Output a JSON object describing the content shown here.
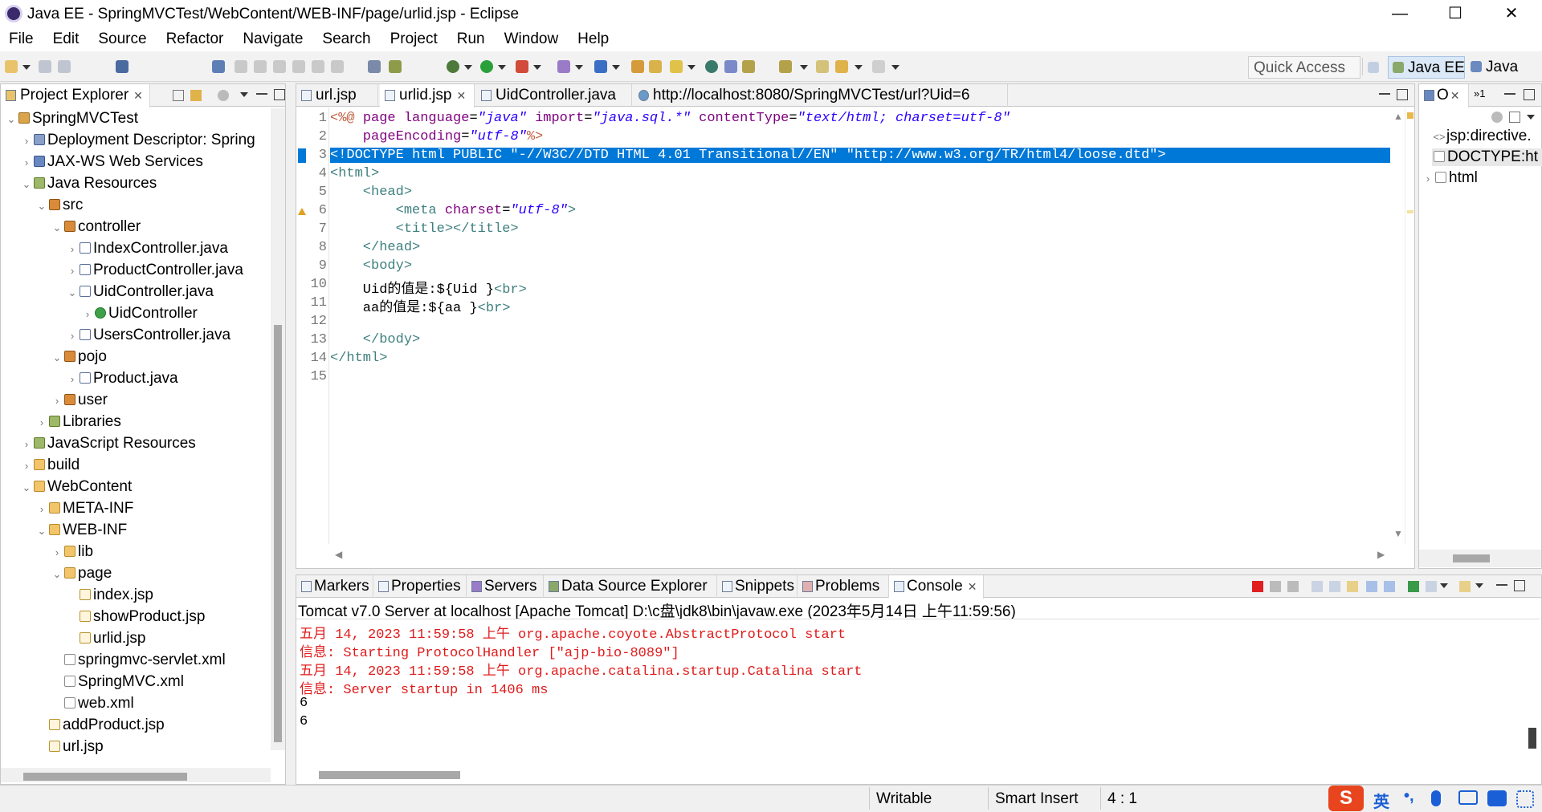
{
  "window": {
    "title": "Java EE - SpringMVCTest/WebContent/WEB-INF/page/urlid.jsp - Eclipse",
    "minimize": "—",
    "maximize": "☐",
    "close": "✕"
  },
  "menu": [
    "File",
    "Edit",
    "Source",
    "Refactor",
    "Navigate",
    "Search",
    "Project",
    "Run",
    "Window",
    "Help"
  ],
  "quick_access": "Quick Access",
  "perspectives": [
    {
      "label": "Java EE",
      "active": true
    },
    {
      "label": "Java",
      "active": false
    }
  ],
  "project_explorer": {
    "title": "Project Explorer",
    "tree": [
      {
        "label": "SpringMVCTest",
        "twisty": "⌄",
        "icon": "proj"
      },
      {
        "label": "Deployment Descriptor: Spring",
        "twisty": "›",
        "icon": "desc"
      },
      {
        "label": "JAX-WS Web Services",
        "twisty": "›",
        "icon": "ws"
      },
      {
        "label": "Java Resources",
        "twisty": "⌄",
        "icon": "lib"
      },
      {
        "label": "src",
        "twisty": "⌄",
        "icon": "pkg"
      },
      {
        "label": "controller",
        "twisty": "⌄",
        "icon": "pkg"
      },
      {
        "label": "IndexController.java",
        "twisty": "›",
        "icon": "java"
      },
      {
        "label": "ProductController.java",
        "twisty": "›",
        "icon": "java"
      },
      {
        "label": "UidController.java",
        "twisty": "⌄",
        "icon": "java"
      },
      {
        "label": "UidController",
        "twisty": "›",
        "icon": "cls"
      },
      {
        "label": "UsersController.java",
        "twisty": "›",
        "icon": "java"
      },
      {
        "label": "pojo",
        "twisty": "⌄",
        "icon": "pkg"
      },
      {
        "label": "Product.java",
        "twisty": "›",
        "icon": "java"
      },
      {
        "label": "user",
        "twisty": "›",
        "icon": "pkg"
      },
      {
        "label": "Libraries",
        "twisty": "›",
        "icon": "lib"
      },
      {
        "label": "JavaScript Resources",
        "twisty": "›",
        "icon": "lib"
      },
      {
        "label": "build",
        "twisty": "›",
        "icon": "folder"
      },
      {
        "label": "WebContent",
        "twisty": "⌄",
        "icon": "folder"
      },
      {
        "label": "META-INF",
        "twisty": "›",
        "icon": "folder"
      },
      {
        "label": "WEB-INF",
        "twisty": "⌄",
        "icon": "folder"
      },
      {
        "label": "lib",
        "twisty": "›",
        "icon": "folder"
      },
      {
        "label": "page",
        "twisty": "⌄",
        "icon": "folder"
      },
      {
        "label": "index.jsp",
        "twisty": "",
        "icon": "jsp"
      },
      {
        "label": "showProduct.jsp",
        "twisty": "",
        "icon": "jsp"
      },
      {
        "label": "urlid.jsp",
        "twisty": "",
        "icon": "jsp"
      },
      {
        "label": "springmvc-servlet.xml",
        "twisty": "",
        "icon": "xml"
      },
      {
        "label": "SpringMVC.xml",
        "twisty": "",
        "icon": "xml"
      },
      {
        "label": "web.xml",
        "twisty": "",
        "icon": "xml"
      },
      {
        "label": "addProduct.jsp",
        "twisty": "",
        "icon": "jsp"
      },
      {
        "label": "url.jsp",
        "twisty": "",
        "icon": "jsp"
      }
    ]
  },
  "editor_tabs": [
    {
      "label": "url.jsp"
    },
    {
      "label": "urlid.jsp",
      "close": "✕"
    },
    {
      "label": "UidController.java"
    },
    {
      "label": "http://localhost:8080/SpringMVCTest/url?Uid=6"
    }
  ],
  "editor_lines": [
    {
      "n": "1"
    },
    {
      "n": "2"
    },
    {
      "n": "3"
    },
    {
      "n": "4"
    },
    {
      "n": "5"
    },
    {
      "n": "6"
    },
    {
      "n": "7"
    },
    {
      "n": "8"
    },
    {
      "n": "9"
    },
    {
      "n": "10"
    },
    {
      "n": "11"
    },
    {
      "n": "12"
    },
    {
      "n": "13"
    },
    {
      "n": "14"
    },
    {
      "n": "15"
    }
  ],
  "code": {
    "l1_a": "<%@ ",
    "l1_b": "page ",
    "l1_c": "language",
    "l1_d": "=",
    "l1_e": "\"java\"",
    "l1_f": " import",
    "l1_g": "=",
    "l1_h": "\"java.sql.*\"",
    "l1_i": " contentType",
    "l1_j": "=",
    "l1_k": "\"text/html; charset=utf-8\"",
    "l2_a": "    pageEncoding",
    "l2_b": "=",
    "l2_c": "\"utf-8\"",
    "l2_d": "%>",
    "l3": "<!DOCTYPE html PUBLIC \"-//W3C//DTD HTML 4.01 Transitional//EN\" \"http://www.w3.org/TR/html4/loose.dtd\">",
    "l4": "<html>",
    "l5": "    <head>",
    "l6_a": "        <meta ",
    "l6_b": "charset",
    "l6_c": "=",
    "l6_d": "\"utf-8\"",
    "l6_e": ">",
    "l7": "        <title></title>",
    "l8": "    </head>",
    "l9": "    <body>",
    "l10_a": "    Uid的值是:${Uid }",
    "l10_b": "<br>",
    "l11_a": "    aa的值是:${aa }",
    "l11_b": "<br>",
    "l12": "",
    "l13": "    </body>",
    "l14": "</html>",
    "l15": ""
  },
  "outline": {
    "tab": "O",
    "tab2": "»1",
    "items": [
      {
        "label": "jsp:directive.",
        "twisty": "<>"
      },
      {
        "label": "DOCTYPE:ht",
        "twisty": ""
      },
      {
        "label": "html",
        "twisty": "›"
      }
    ]
  },
  "bottom_tabs": [
    {
      "label": "Markers"
    },
    {
      "label": "Properties"
    },
    {
      "label": "Servers"
    },
    {
      "label": "Data Source Explorer"
    },
    {
      "label": "Snippets"
    },
    {
      "label": "Problems"
    },
    {
      "label": "Console",
      "close": "✕"
    }
  ],
  "console": {
    "header": "Tomcat v7.0 Server at localhost [Apache Tomcat] D:\\c盘\\jdk8\\bin\\javaw.exe (2023年5月14日 上午11:59:56)",
    "lines": [
      {
        "text": "五月 14, 2023 11:59:58 上午 org.apache.coyote.AbstractProtocol start",
        "color": "red"
      },
      {
        "text": "信息: Starting ProtocolHandler [\"ajp-bio-8089\"]",
        "color": "red"
      },
      {
        "text": "五月 14, 2023 11:59:58 上午 org.apache.catalina.startup.Catalina start",
        "color": "red"
      },
      {
        "text": "信息: Server startup in 1406 ms",
        "color": "red"
      },
      {
        "text": "6",
        "color": "black"
      },
      {
        "text": "6",
        "color": "black"
      }
    ]
  },
  "status": {
    "writable": "Writable",
    "insert": "Smart Insert",
    "position": "4 : 1",
    "ime": "英"
  }
}
